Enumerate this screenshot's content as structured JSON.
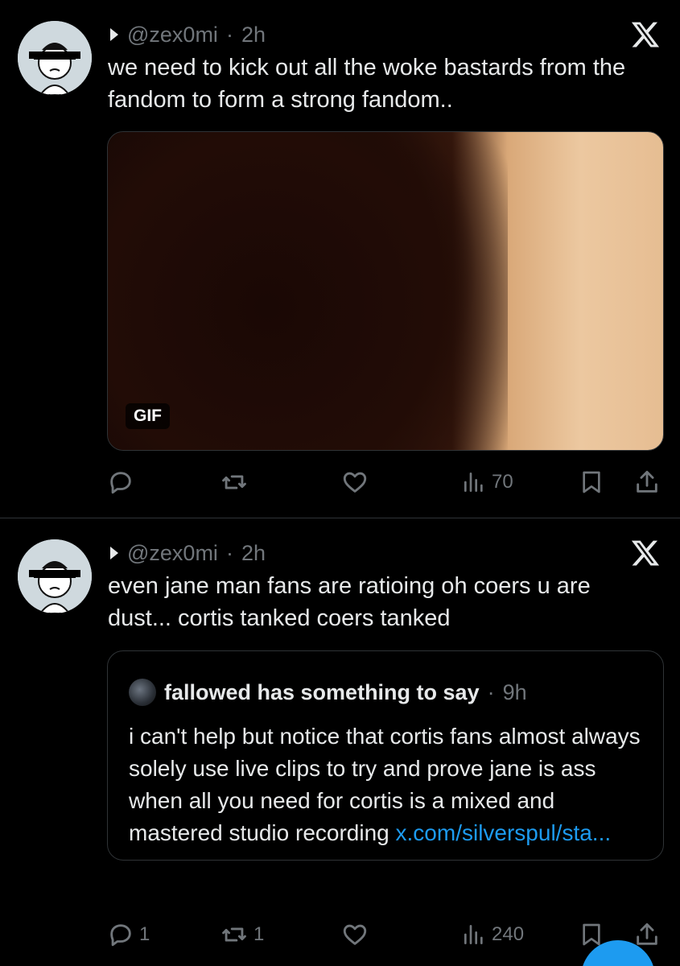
{
  "tweets": [
    {
      "handle": "@zex0mi",
      "time": "2h",
      "text": "we need to kick out all the woke bastards from the fandom to form a strong fandom..",
      "media": {
        "badge": "GIF"
      },
      "actions": {
        "replies": "",
        "reposts": "",
        "likes": "",
        "views": "70"
      }
    },
    {
      "handle": "@zex0mi",
      "time": "2h",
      "text": "even jane man fans are ratioing oh coers u are dust... cortis tanked coers tanked",
      "quote": {
        "name": "fallowed has something to say",
        "time": "9h",
        "text": "i can't help but notice that cortis fans almost always solely use live clips to try and prove jane is ass when all you need for cortis is a mixed and mastered studio recording",
        "link": "x.com/silverspul/sta..."
      },
      "actions": {
        "replies": "1",
        "reposts": "1",
        "likes": "",
        "views": "240"
      }
    }
  ],
  "icons": {
    "close": "x-logo-icon",
    "reply": "reply-icon",
    "repost": "repost-icon",
    "like": "heart-icon",
    "views": "views-icon",
    "bookmark": "bookmark-icon",
    "share": "share-icon"
  },
  "colors": {
    "background": "#000000",
    "text": "#e7e9ea",
    "muted": "#71767b",
    "link": "#1d9bf0",
    "border": "#2f3336"
  }
}
